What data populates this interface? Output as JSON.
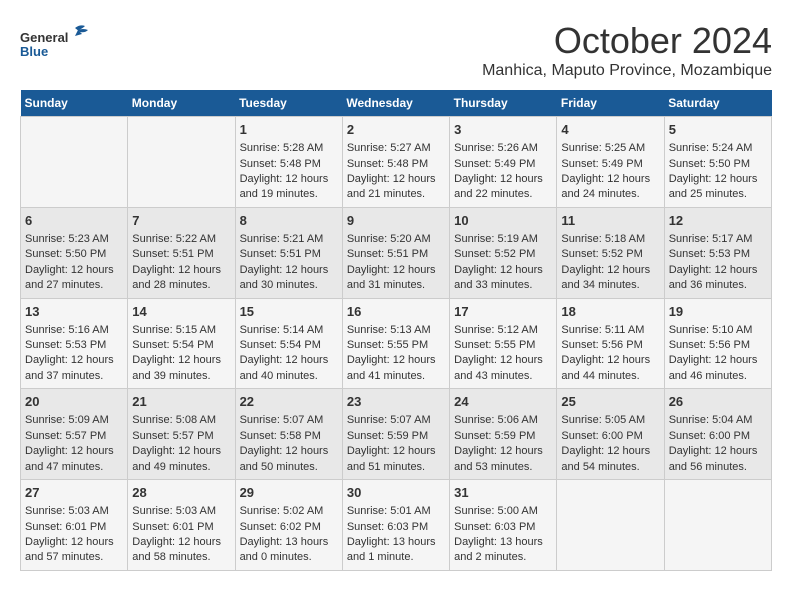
{
  "header": {
    "logo_general": "General",
    "logo_blue": "Blue",
    "title": "October 2024",
    "subtitle": "Manhica, Maputo Province, Mozambique"
  },
  "days_of_week": [
    "Sunday",
    "Monday",
    "Tuesday",
    "Wednesday",
    "Thursday",
    "Friday",
    "Saturday"
  ],
  "weeks": [
    [
      {
        "day": "",
        "sunrise": "",
        "sunset": "",
        "daylight": ""
      },
      {
        "day": "",
        "sunrise": "",
        "sunset": "",
        "daylight": ""
      },
      {
        "day": "1",
        "sunrise": "Sunrise: 5:28 AM",
        "sunset": "Sunset: 5:48 PM",
        "daylight": "Daylight: 12 hours and 19 minutes."
      },
      {
        "day": "2",
        "sunrise": "Sunrise: 5:27 AM",
        "sunset": "Sunset: 5:48 PM",
        "daylight": "Daylight: 12 hours and 21 minutes."
      },
      {
        "day": "3",
        "sunrise": "Sunrise: 5:26 AM",
        "sunset": "Sunset: 5:49 PM",
        "daylight": "Daylight: 12 hours and 22 minutes."
      },
      {
        "day": "4",
        "sunrise": "Sunrise: 5:25 AM",
        "sunset": "Sunset: 5:49 PM",
        "daylight": "Daylight: 12 hours and 24 minutes."
      },
      {
        "day": "5",
        "sunrise": "Sunrise: 5:24 AM",
        "sunset": "Sunset: 5:50 PM",
        "daylight": "Daylight: 12 hours and 25 minutes."
      }
    ],
    [
      {
        "day": "6",
        "sunrise": "Sunrise: 5:23 AM",
        "sunset": "Sunset: 5:50 PM",
        "daylight": "Daylight: 12 hours and 27 minutes."
      },
      {
        "day": "7",
        "sunrise": "Sunrise: 5:22 AM",
        "sunset": "Sunset: 5:51 PM",
        "daylight": "Daylight: 12 hours and 28 minutes."
      },
      {
        "day": "8",
        "sunrise": "Sunrise: 5:21 AM",
        "sunset": "Sunset: 5:51 PM",
        "daylight": "Daylight: 12 hours and 30 minutes."
      },
      {
        "day": "9",
        "sunrise": "Sunrise: 5:20 AM",
        "sunset": "Sunset: 5:51 PM",
        "daylight": "Daylight: 12 hours and 31 minutes."
      },
      {
        "day": "10",
        "sunrise": "Sunrise: 5:19 AM",
        "sunset": "Sunset: 5:52 PM",
        "daylight": "Daylight: 12 hours and 33 minutes."
      },
      {
        "day": "11",
        "sunrise": "Sunrise: 5:18 AM",
        "sunset": "Sunset: 5:52 PM",
        "daylight": "Daylight: 12 hours and 34 minutes."
      },
      {
        "day": "12",
        "sunrise": "Sunrise: 5:17 AM",
        "sunset": "Sunset: 5:53 PM",
        "daylight": "Daylight: 12 hours and 36 minutes."
      }
    ],
    [
      {
        "day": "13",
        "sunrise": "Sunrise: 5:16 AM",
        "sunset": "Sunset: 5:53 PM",
        "daylight": "Daylight: 12 hours and 37 minutes."
      },
      {
        "day": "14",
        "sunrise": "Sunrise: 5:15 AM",
        "sunset": "Sunset: 5:54 PM",
        "daylight": "Daylight: 12 hours and 39 minutes."
      },
      {
        "day": "15",
        "sunrise": "Sunrise: 5:14 AM",
        "sunset": "Sunset: 5:54 PM",
        "daylight": "Daylight: 12 hours and 40 minutes."
      },
      {
        "day": "16",
        "sunrise": "Sunrise: 5:13 AM",
        "sunset": "Sunset: 5:55 PM",
        "daylight": "Daylight: 12 hours and 41 minutes."
      },
      {
        "day": "17",
        "sunrise": "Sunrise: 5:12 AM",
        "sunset": "Sunset: 5:55 PM",
        "daylight": "Daylight: 12 hours and 43 minutes."
      },
      {
        "day": "18",
        "sunrise": "Sunrise: 5:11 AM",
        "sunset": "Sunset: 5:56 PM",
        "daylight": "Daylight: 12 hours and 44 minutes."
      },
      {
        "day": "19",
        "sunrise": "Sunrise: 5:10 AM",
        "sunset": "Sunset: 5:56 PM",
        "daylight": "Daylight: 12 hours and 46 minutes."
      }
    ],
    [
      {
        "day": "20",
        "sunrise": "Sunrise: 5:09 AM",
        "sunset": "Sunset: 5:57 PM",
        "daylight": "Daylight: 12 hours and 47 minutes."
      },
      {
        "day": "21",
        "sunrise": "Sunrise: 5:08 AM",
        "sunset": "Sunset: 5:57 PM",
        "daylight": "Daylight: 12 hours and 49 minutes."
      },
      {
        "day": "22",
        "sunrise": "Sunrise: 5:07 AM",
        "sunset": "Sunset: 5:58 PM",
        "daylight": "Daylight: 12 hours and 50 minutes."
      },
      {
        "day": "23",
        "sunrise": "Sunrise: 5:07 AM",
        "sunset": "Sunset: 5:59 PM",
        "daylight": "Daylight: 12 hours and 51 minutes."
      },
      {
        "day": "24",
        "sunrise": "Sunrise: 5:06 AM",
        "sunset": "Sunset: 5:59 PM",
        "daylight": "Daylight: 12 hours and 53 minutes."
      },
      {
        "day": "25",
        "sunrise": "Sunrise: 5:05 AM",
        "sunset": "Sunset: 6:00 PM",
        "daylight": "Daylight: 12 hours and 54 minutes."
      },
      {
        "day": "26",
        "sunrise": "Sunrise: 5:04 AM",
        "sunset": "Sunset: 6:00 PM",
        "daylight": "Daylight: 12 hours and 56 minutes."
      }
    ],
    [
      {
        "day": "27",
        "sunrise": "Sunrise: 5:03 AM",
        "sunset": "Sunset: 6:01 PM",
        "daylight": "Daylight: 12 hours and 57 minutes."
      },
      {
        "day": "28",
        "sunrise": "Sunrise: 5:03 AM",
        "sunset": "Sunset: 6:01 PM",
        "daylight": "Daylight: 12 hours and 58 minutes."
      },
      {
        "day": "29",
        "sunrise": "Sunrise: 5:02 AM",
        "sunset": "Sunset: 6:02 PM",
        "daylight": "Daylight: 13 hours and 0 minutes."
      },
      {
        "day": "30",
        "sunrise": "Sunrise: 5:01 AM",
        "sunset": "Sunset: 6:03 PM",
        "daylight": "Daylight: 13 hours and 1 minute."
      },
      {
        "day": "31",
        "sunrise": "Sunrise: 5:00 AM",
        "sunset": "Sunset: 6:03 PM",
        "daylight": "Daylight: 13 hours and 2 minutes."
      },
      {
        "day": "",
        "sunrise": "",
        "sunset": "",
        "daylight": ""
      },
      {
        "day": "",
        "sunrise": "",
        "sunset": "",
        "daylight": ""
      }
    ]
  ]
}
